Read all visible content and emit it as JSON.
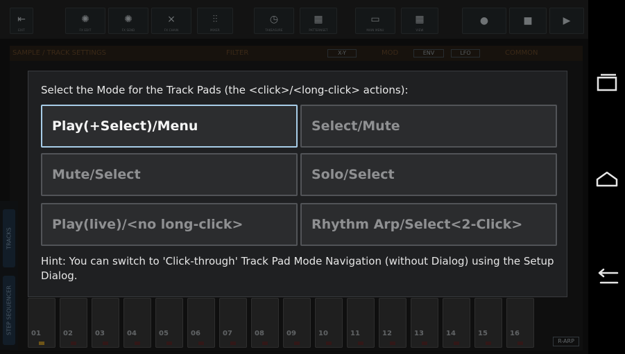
{
  "toolbar": {
    "buttons": [
      {
        "label": "EXIT"
      },
      {
        "label": "FX EDIT"
      },
      {
        "label": "FX SEND"
      },
      {
        "label": "FX CHAIN"
      },
      {
        "label": "MIXER"
      },
      {
        "label": "TAKEASURE"
      },
      {
        "label": "PATTERNSET"
      },
      {
        "label": "MAIN MENU"
      },
      {
        "label": "VIEW"
      }
    ]
  },
  "panel": {
    "header": "SAMPLE / TRACK SETTINGS",
    "filter": "FILTER",
    "xy": "X-Y",
    "mod": "MOD",
    "env": "ENV",
    "lfo": "LFO",
    "common": "COMMON"
  },
  "side_tabs": {
    "tracks": "TRACKS",
    "step_sequencer": "STEP SEQUENCER"
  },
  "pads": [
    "01",
    "02",
    "03",
    "04",
    "05",
    "06",
    "07",
    "08",
    "09",
    "10",
    "11",
    "12",
    "13",
    "14",
    "15",
    "16"
  ],
  "rarp_label": "R-ARP",
  "dialog": {
    "title": "Select the Mode for the Track Pads (the <click>/<long-click> actions):",
    "options": [
      {
        "label": "Play(+Select)/Menu",
        "selected": true
      },
      {
        "label": "Select/Mute",
        "selected": false
      },
      {
        "label": "Mute/Select",
        "selected": false
      },
      {
        "label": "Solo/Select",
        "selected": false
      },
      {
        "label": "Play(live)/<no long-click>",
        "selected": false
      },
      {
        "label": "Rhythm Arp/Select<2-Click>",
        "selected": false
      }
    ],
    "hint": "Hint: You can switch to 'Click-through' Track Pad Mode Navigation (without Dialog) using the Setup Dialog."
  },
  "navbar": {
    "icons": [
      "recents-icon",
      "home-icon",
      "back-icon"
    ]
  },
  "colors": {
    "accent_selected": "#a8cde8",
    "dialog_bg": "#1f2022"
  }
}
